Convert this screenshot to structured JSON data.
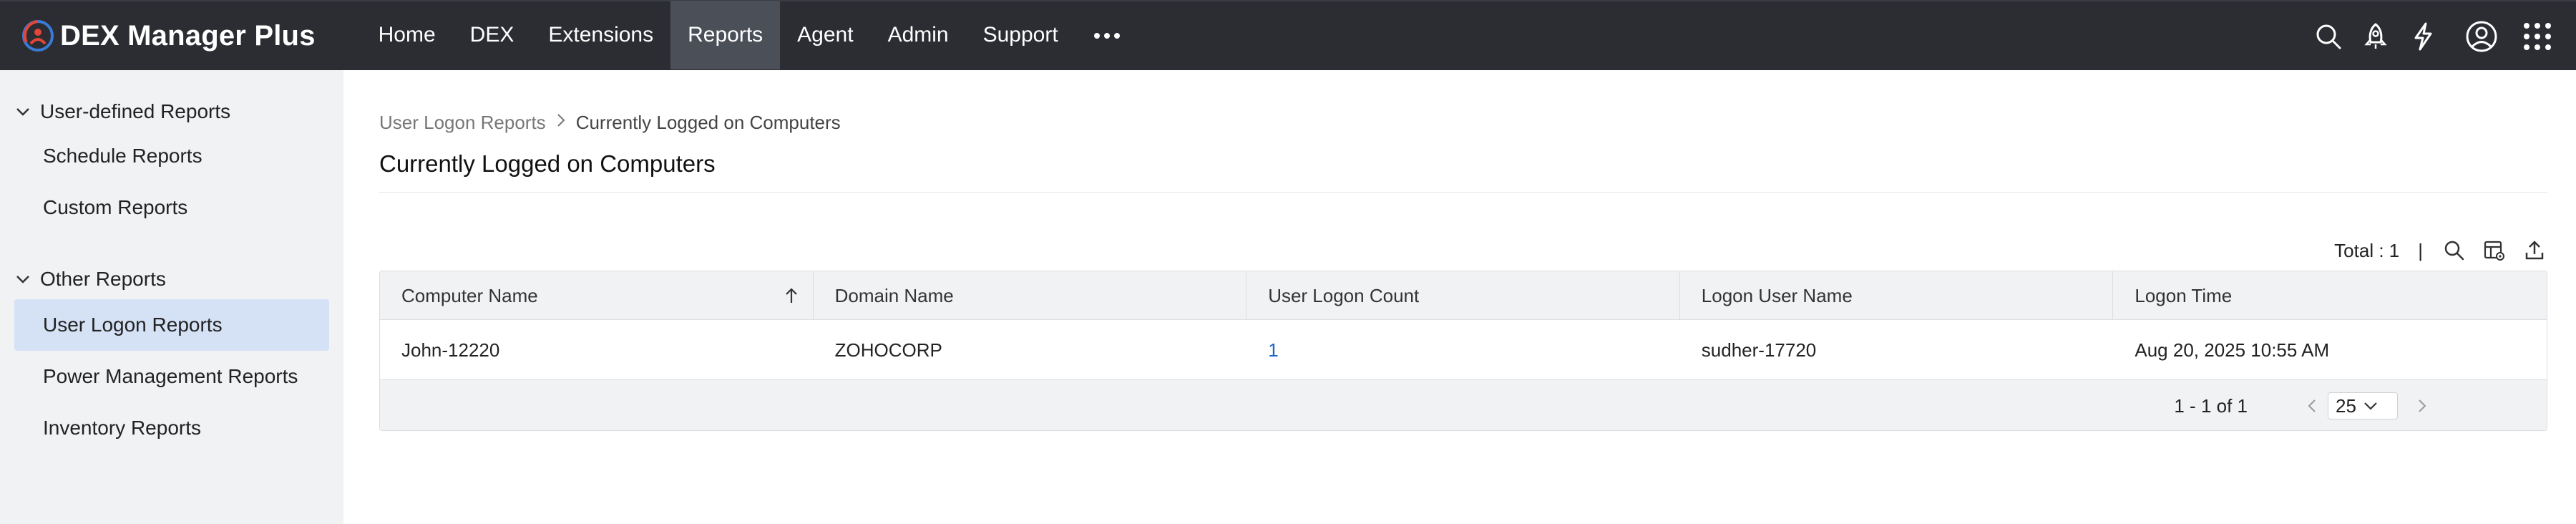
{
  "app": {
    "title": "DEX Manager Plus"
  },
  "nav": {
    "items": [
      "Home",
      "DEX",
      "Extensions",
      "Reports",
      "Agent",
      "Admin",
      "Support"
    ],
    "active": "Reports",
    "more_icon": "more-dots-icon"
  },
  "top_icons": [
    "search-icon",
    "rocket-icon",
    "lightning-icon",
    "user-account-icon",
    "apps-grid-icon"
  ],
  "sidebar": {
    "groups": [
      {
        "label": "User-defined Reports",
        "items": [
          "Schedule Reports",
          "Custom Reports"
        ]
      },
      {
        "label": "Other Reports",
        "items": [
          "User Logon Reports",
          "Power Management Reports",
          "Inventory Reports"
        ]
      }
    ],
    "active_item": "User Logon Reports"
  },
  "breadcrumb": {
    "parent": "User Logon Reports",
    "current": "Currently Logged on Computers"
  },
  "page": {
    "title": "Currently Logged on Computers"
  },
  "toolbar": {
    "total": "Total : 1",
    "separator": "|"
  },
  "table": {
    "columns": [
      "Computer Name",
      "Domain Name",
      "User Logon Count",
      "Logon User Name",
      "Logon Time"
    ],
    "rows": [
      [
        "John-12220",
        "ZOHOCORP",
        "1",
        "sudher-17720",
        "Aug 20, 2025 10:55 AM"
      ]
    ]
  },
  "pagination": {
    "range": "1 - 1 of 1",
    "page_size": "25"
  },
  "colors": {
    "topbar": "#2b2d33",
    "active_nav": "#4b4f58",
    "sidebar": "#f1f2f4",
    "sidebar_active": "#d5e1f5",
    "link": "#1a66c9",
    "logo_red": "#e0463a",
    "logo_blue": "#3a7bd5"
  }
}
